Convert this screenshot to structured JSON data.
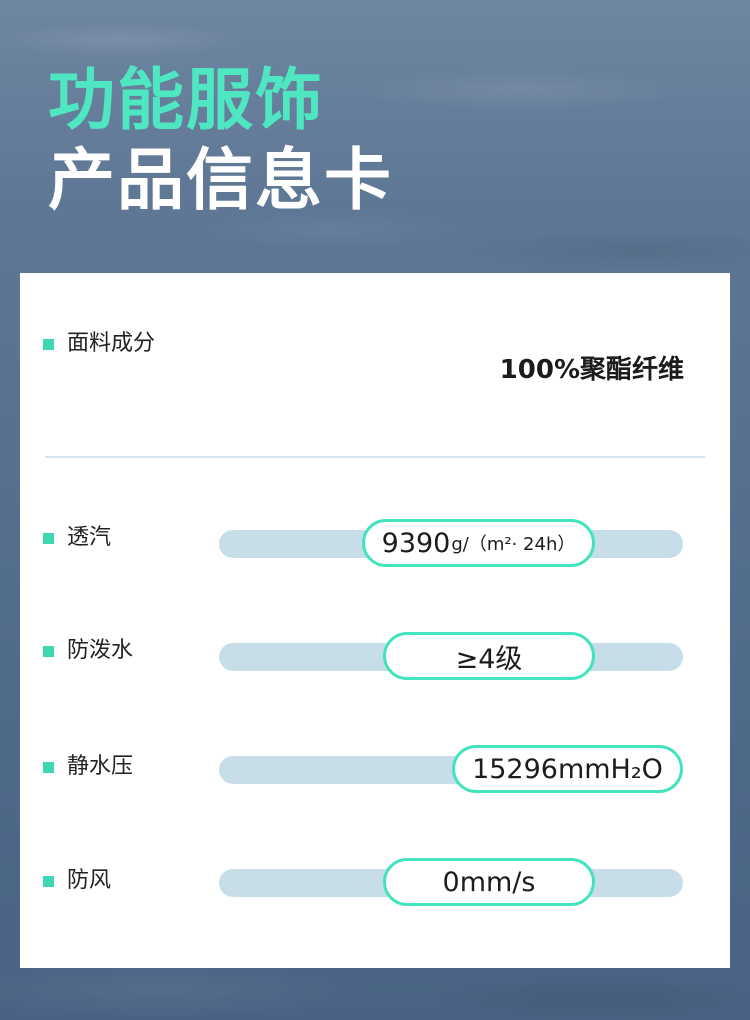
{
  "header": {
    "title_line1": "功能服饰",
    "title_line2": "产品信息卡"
  },
  "colors": {
    "accent": "#4fe6c2",
    "track": "#c7dde7",
    "card_background": "#ffffff"
  },
  "composition": {
    "label": "面料成分",
    "value": "100%聚酯纤维"
  },
  "properties": [
    {
      "label": "透汽",
      "value": "9390",
      "unit": "g/（m²· 24h）"
    },
    {
      "label": "防泼水",
      "value": "≥4级",
      "unit": ""
    },
    {
      "label": "静水压",
      "value": "15296mmH₂O",
      "unit": ""
    },
    {
      "label": "防风",
      "value": "0mm/s",
      "unit": ""
    }
  ]
}
